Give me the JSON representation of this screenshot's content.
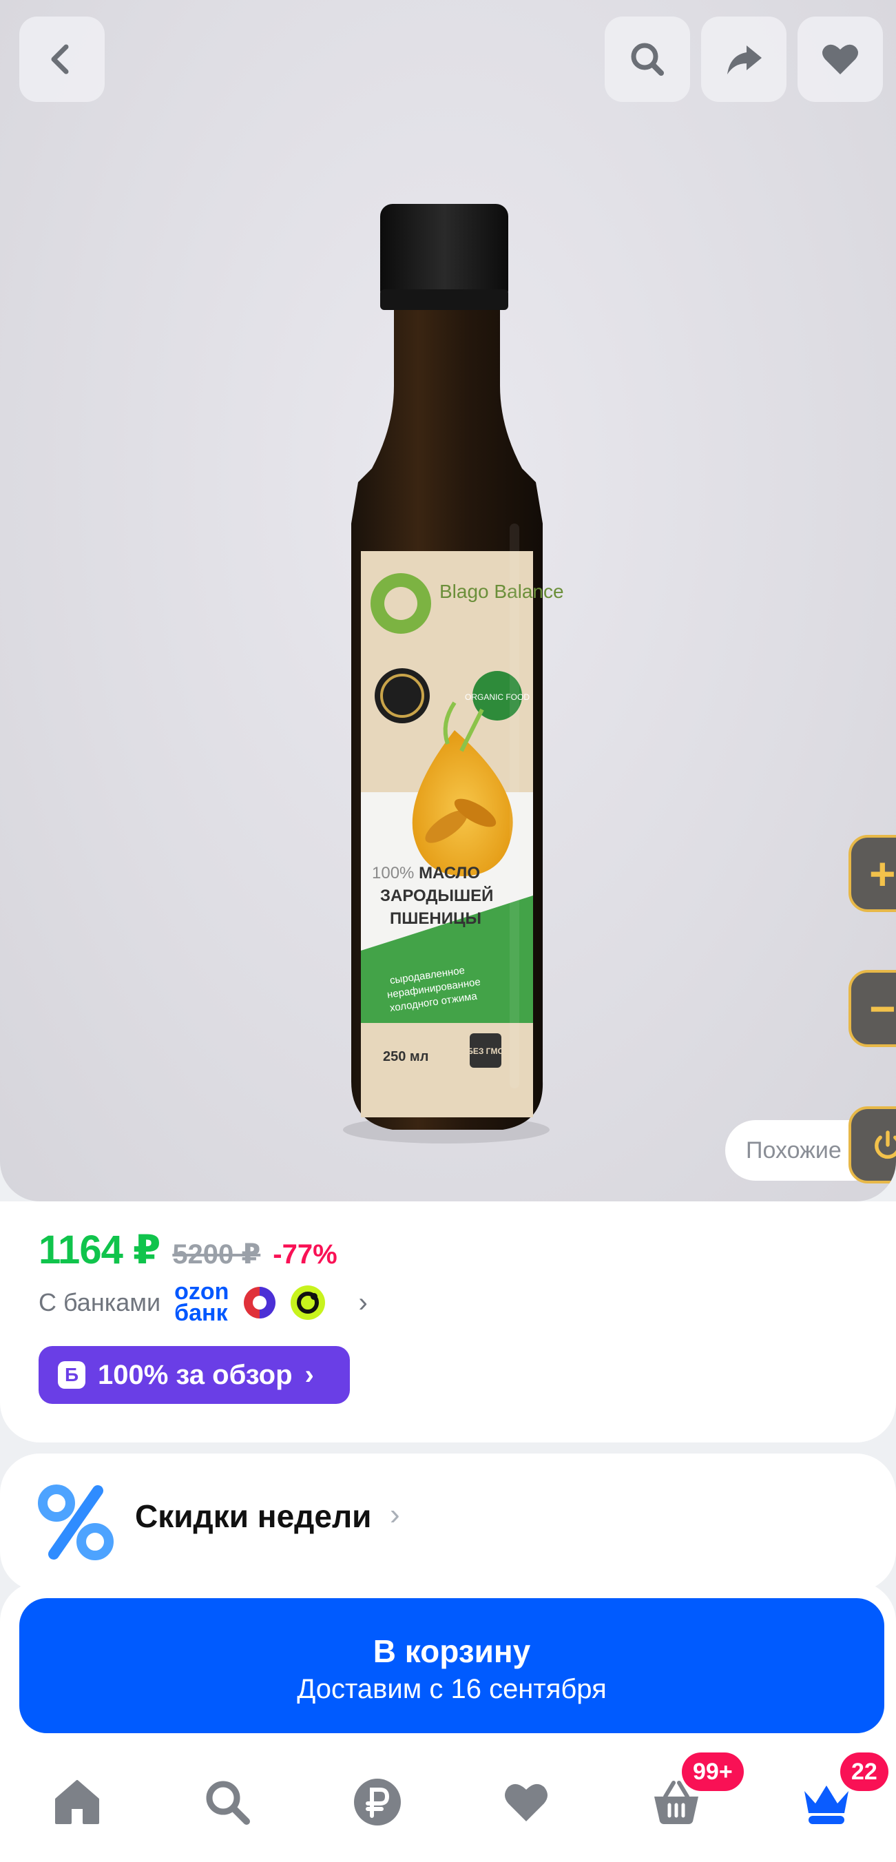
{
  "product": {
    "label_brand": "Blago Balance",
    "label_badge": "ORGANIC FOOD",
    "label_percent": "100%",
    "label_name_line1": "МАСЛО",
    "label_name_line2": "ЗАРОДЫШЕЙ",
    "label_name_line3": "ПШЕНИЦЫ",
    "label_desc_line1": "сыродавленное",
    "label_desc_line2": "нерафинированное",
    "label_desc_line3": "холодного отжима",
    "label_volume": "250 мл",
    "label_gmo": "БЕЗ ГМО"
  },
  "side_controls": {
    "zoom_in": "+",
    "zoom_out": "−"
  },
  "similar_label": "Похожие",
  "price": {
    "current": "1164 ₽",
    "old": "5200 ₽",
    "discount": "-77%",
    "banks_label": "С банками",
    "ozon_line1": "ozon",
    "ozon_line2": "банк",
    "review_badge": "Б",
    "review_label": "100% за обзор"
  },
  "weekly": {
    "label": "Скидки недели",
    "chevron": "›"
  },
  "cart": {
    "title": "В корзину",
    "subtitle": "Доставим с 16 сентября"
  },
  "nav": {
    "cart_badge": "99+",
    "profile_badge": "22"
  },
  "colors": {
    "accent": "#005bff",
    "price_green": "#10c44c",
    "discount_pink": "#f91155",
    "review_purple": "#6a3ee6"
  }
}
